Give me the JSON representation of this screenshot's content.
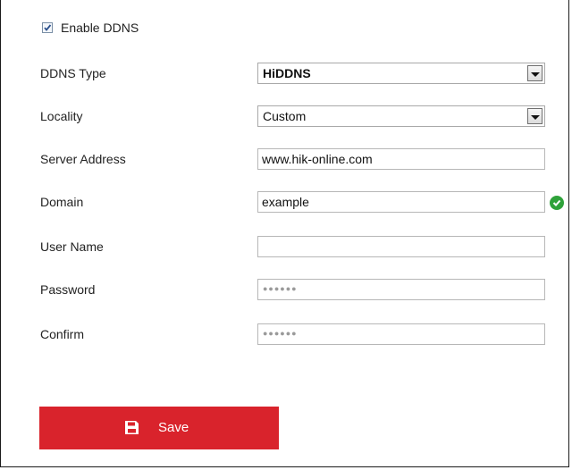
{
  "enable_ddns": {
    "label": "Enable DDNS",
    "checked": true
  },
  "fields": {
    "ddns_type": {
      "label": "DDNS Type",
      "value": "HiDDNS"
    },
    "locality": {
      "label": "Locality",
      "value": "Custom"
    },
    "server_address": {
      "label": "Server Address",
      "value": "www.hik-online.com"
    },
    "domain": {
      "label": "Domain",
      "value": "example",
      "status_icon": "check-circle-icon"
    },
    "user_name": {
      "label": "User Name",
      "value": ""
    },
    "password": {
      "label": "Password",
      "masked_value": "●●●●●●"
    },
    "confirm": {
      "label": "Confirm",
      "masked_value": "●●●●●●"
    }
  },
  "save_button": {
    "label": "Save",
    "icon": "floppy-disk-icon",
    "color": "#d9232c"
  },
  "colors": {
    "ok_green": "#2fa23a",
    "checkbox_tick": "#2a4f8c"
  }
}
